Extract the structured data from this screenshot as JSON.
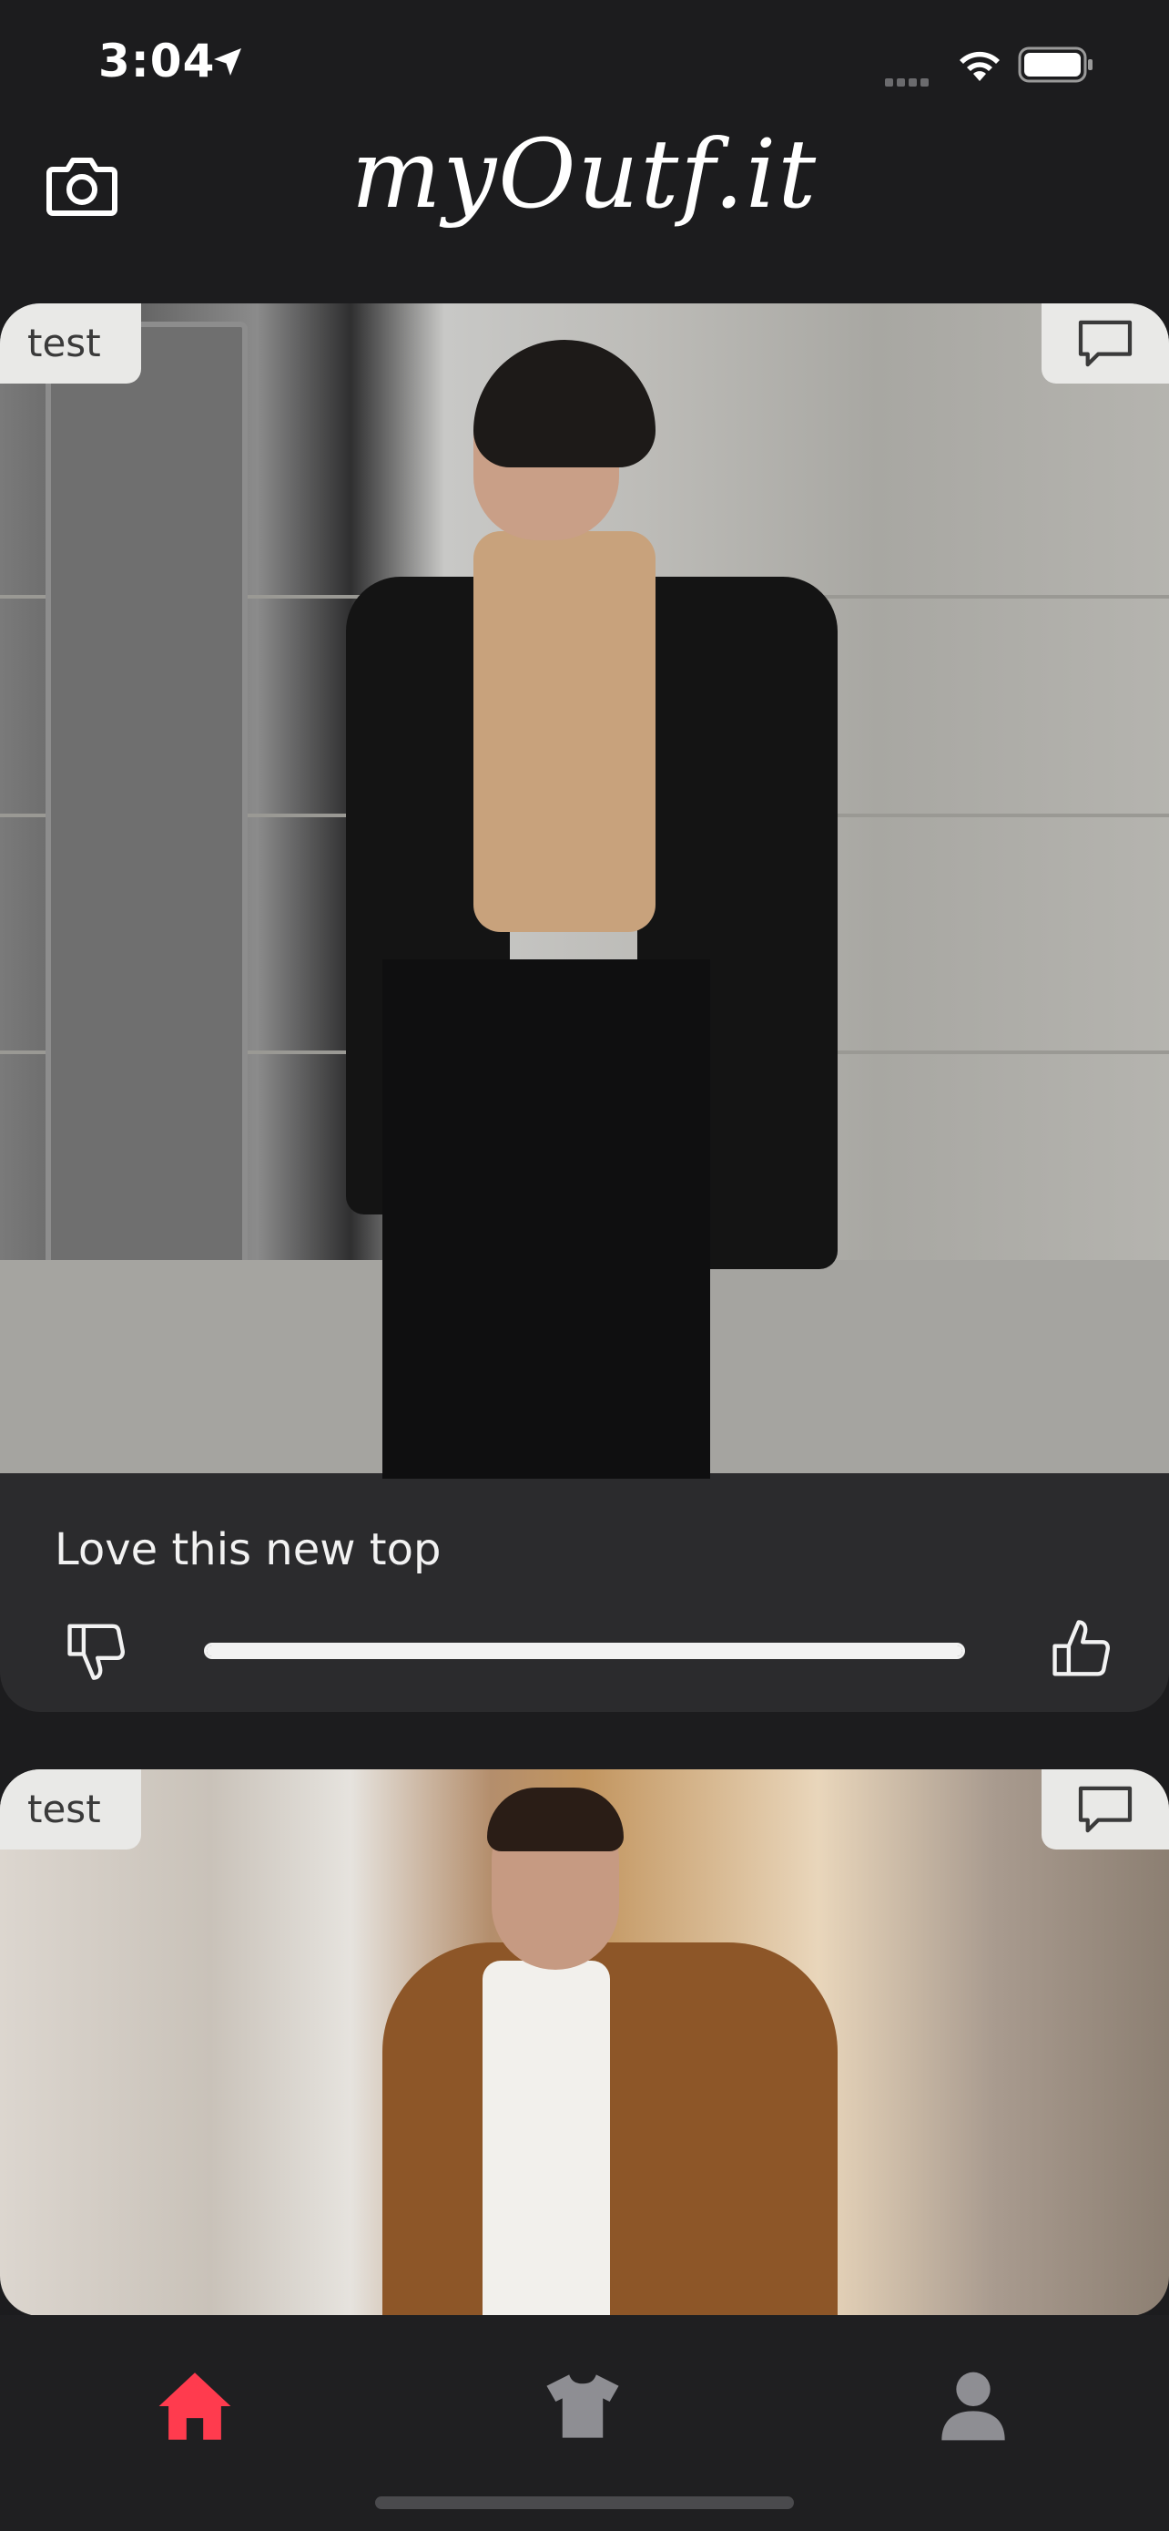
{
  "status_bar": {
    "time": "3:04",
    "icons": [
      "location-arrow-icon",
      "signal-icon",
      "wifi-icon",
      "battery-icon"
    ]
  },
  "header": {
    "logo": "myOutf.it",
    "left_icon": "camera-icon"
  },
  "posts": [
    {
      "tag": "test",
      "caption": "Love this new top",
      "comment_icon": "comment-icon",
      "vote_progress": 1.0
    },
    {
      "tag": "test",
      "comment_icon": "comment-icon"
    }
  ],
  "tab_bar": {
    "active": "home",
    "active_color": "#ff3b4e",
    "inactive_color": "#8e8e93",
    "tabs": [
      "home-icon",
      "shirt-icon",
      "profile-icon"
    ]
  }
}
